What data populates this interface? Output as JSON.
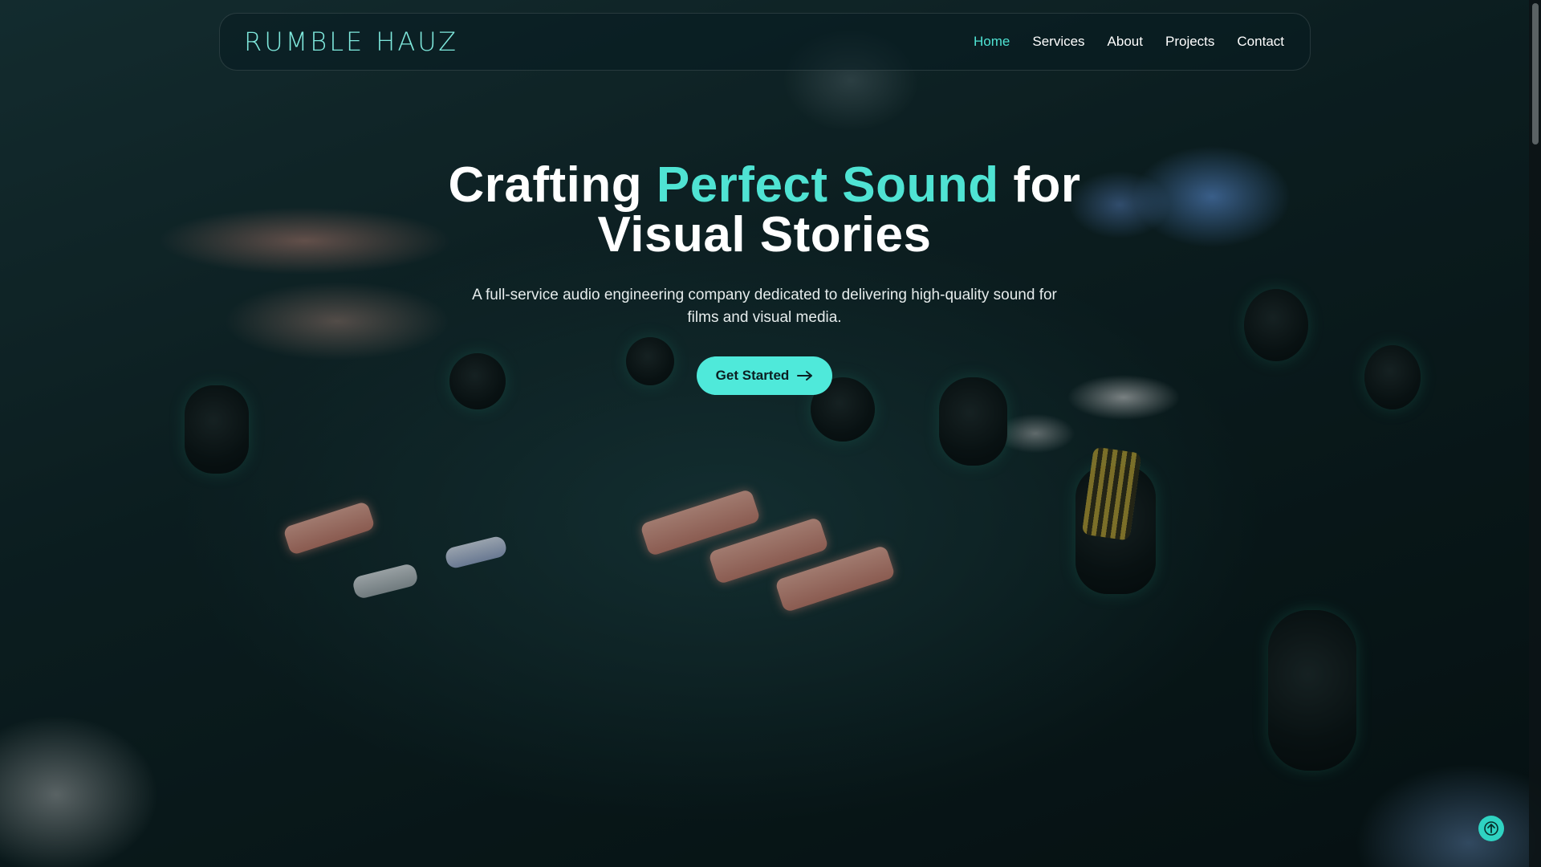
{
  "header": {
    "logo_word1": "RUMBLE",
    "logo_word2": "HAUZ",
    "nav": [
      {
        "label": "Home",
        "active": true
      },
      {
        "label": "Services",
        "active": false
      },
      {
        "label": "About",
        "active": false
      },
      {
        "label": "Projects",
        "active": false
      },
      {
        "label": "Contact",
        "active": false
      }
    ]
  },
  "hero": {
    "title_prefix": "Crafting ",
    "title_accent": "Perfect Sound",
    "title_suffix_1": " for",
    "title_line2": "Visual Stories",
    "subtitle": "A full-service audio engineering company dedicated to delivering high-quality sound for films and visual media.",
    "cta_label": "Get Started",
    "cta_icon": "arrow-right-icon"
  },
  "scroll_top": {
    "icon": "arrow-up-icon"
  },
  "colors": {
    "accent": "#4fe3d3",
    "button": "#4fe9da",
    "text": "#ffffff"
  }
}
